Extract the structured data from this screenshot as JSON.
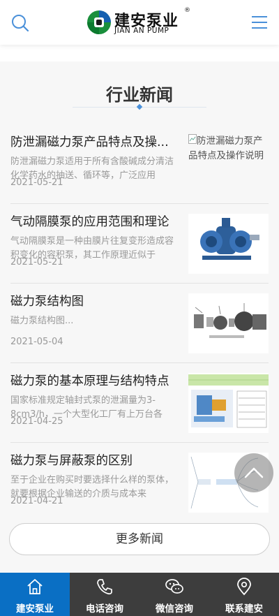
{
  "header": {
    "logo_cn": "建安泵业",
    "logo_en": "JIAN AN PUMP",
    "logo_reg": "®"
  },
  "section": {
    "title": "行业新闻"
  },
  "news": [
    {
      "title": "防泄漏磁力泵产品特点及操...",
      "summary": "防泄漏磁力泵适用于所有含酸碱成分清洁化学药水的抽送、循环等，广泛应用",
      "date": "2021-05-21",
      "thumb_alt": "防泄漏磁力泵产品特点及操作说明"
    },
    {
      "title": "气动隔膜泵的应用范围和理论",
      "summary": "气动隔膜泵是一种由膜片往复变形造成容积变化的容积泵，其工作原理近似于",
      "date": "2021-05-21"
    },
    {
      "title": "磁力泵结构图",
      "summary": "磁力泵结构图...",
      "date": "2021-05-04"
    },
    {
      "title": "磁力泵的基本原理与结构特点",
      "summary": "国家标准规定轴封式泵的泄漏量为3-8cm3/h，一个大型化工厂有上万台各",
      "date": "2021-04-25"
    },
    {
      "title": "磁力泵与屏蔽泵的区别",
      "summary": "至于企业在购买时要选择什么样的泵体，就要根据企业输送的介质与成本来",
      "date": "2021-04-21"
    }
  ],
  "more_button": "更多新闻",
  "bottom_nav": [
    {
      "label": "建安泵业",
      "icon": "home-icon",
      "active": true
    },
    {
      "label": "电话咨询",
      "icon": "phone-icon",
      "active": false
    },
    {
      "label": "微信咨询",
      "icon": "wechat-icon",
      "active": false
    },
    {
      "label": "联系建安",
      "icon": "location-icon",
      "active": false
    }
  ],
  "colors": {
    "accent_blue": "#0a6fc4",
    "icon_blue": "#4a90d9",
    "nav_bg": "#3d3d3d"
  }
}
